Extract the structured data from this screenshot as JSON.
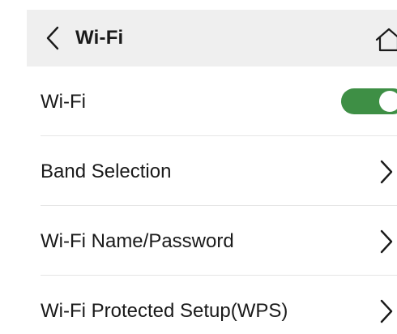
{
  "header": {
    "title": "Wi-Fi",
    "back_icon": "chevron-left-icon",
    "home_icon": "home-icon"
  },
  "wifi_toggle": {
    "label": "Wi-Fi",
    "enabled": true,
    "on_color": "#3e8f45"
  },
  "menu": [
    {
      "label": "Band Selection",
      "icon": "chevron-right-icon"
    },
    {
      "label": "Wi-Fi Name/Password",
      "icon": "chevron-right-icon"
    },
    {
      "label": "Wi-Fi Protected Setup(WPS)",
      "icon": "chevron-right-icon"
    }
  ]
}
